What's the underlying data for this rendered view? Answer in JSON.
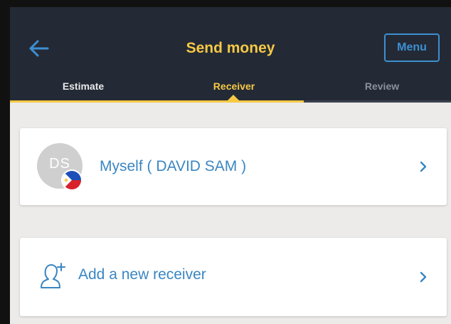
{
  "header": {
    "title": "Send money",
    "menu_label": "Menu",
    "back_icon": "back-arrow-icon"
  },
  "tabs": [
    {
      "label": "Estimate",
      "state": "completed"
    },
    {
      "label": "Receiver",
      "state": "active"
    },
    {
      "label": "Review",
      "state": "upcoming"
    }
  ],
  "progress": {
    "completed_steps": 2,
    "total_steps": 3
  },
  "receivers": [
    {
      "initials": "DS",
      "name": "Myself ( DAVID SAM )",
      "flag_icon": "philippines-flag-icon"
    }
  ],
  "add_receiver": {
    "label": "Add a new receiver",
    "icon": "add-person-icon"
  },
  "colors": {
    "header_bg": "#232a36",
    "accent_yellow": "#f6c844",
    "link_blue": "#3a86c2",
    "menu_blue": "#3d8fd0",
    "page_bg": "#ecebe9"
  }
}
